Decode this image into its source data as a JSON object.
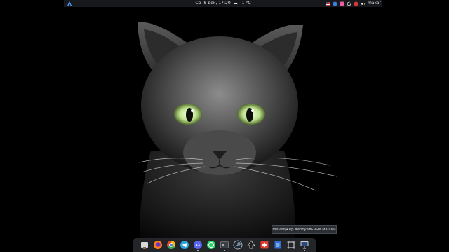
{
  "topbar": {
    "day": "Ср",
    "date": "8 дек, 17:20",
    "weather_icon": "cloud-icon",
    "temperature": "-1 °C",
    "username": "makar",
    "tray_icons": [
      "us-flag-icon",
      "blue-app-icon",
      "pink-app-icon",
      "refresh-icon",
      "red-app-icon",
      "speaker-icon"
    ]
  },
  "tooltip": {
    "text": "Менеджер виртуальных машин"
  },
  "dock": {
    "items": [
      {
        "name": "files-icon",
        "color": "#d9d9d9"
      },
      {
        "name": "firefox-icon",
        "color": "#ff7a18"
      },
      {
        "name": "chrome-icon",
        "color": "#e0463a"
      },
      {
        "name": "telegram-icon",
        "color": "#2aa3de"
      },
      {
        "name": "discord-icon",
        "color": "#5865f2"
      },
      {
        "name": "whatsapp-icon",
        "color": "#25d366"
      },
      {
        "name": "terminal-icon",
        "color": "#3a3f44"
      },
      {
        "name": "steam-icon",
        "color": "#cfd6de"
      },
      {
        "name": "inkscape-icon",
        "color": "#e8e8e8"
      },
      {
        "name": "anydesk-icon",
        "color": "#e33b2e"
      },
      {
        "name": "writer-icon",
        "color": "#2e6fcf"
      },
      {
        "name": "screenshot-icon",
        "color": "#e8e8e8"
      },
      {
        "name": "virtual-machine-manager-icon",
        "color": "#c8d2e0"
      }
    ]
  },
  "colors": {
    "panel": "#16181c",
    "dock": "#26282c",
    "cat_eye": "#c9e3a0"
  }
}
